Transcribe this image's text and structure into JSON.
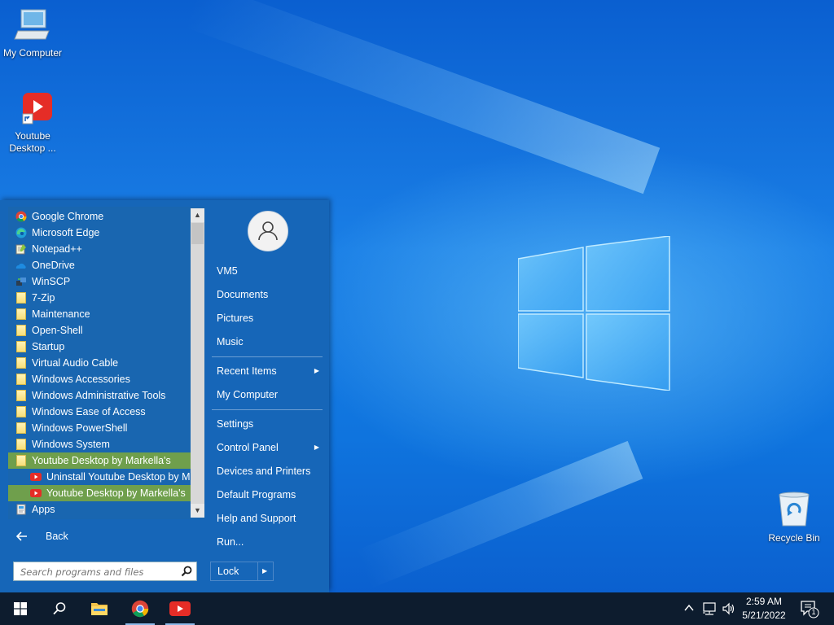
{
  "desktop": {
    "icons": [
      {
        "label": "My Computer"
      },
      {
        "label": "Youtube Desktop ..."
      },
      {
        "label": "Recycle Bin"
      }
    ]
  },
  "start_menu": {
    "programs": [
      {
        "label": "Google Chrome",
        "icon": "chrome-icon"
      },
      {
        "label": "Microsoft Edge",
        "icon": "edge-icon"
      },
      {
        "label": "Notepad++",
        "icon": "notepadpp-icon"
      },
      {
        "label": "OneDrive",
        "icon": "onedrive-icon"
      },
      {
        "label": "WinSCP",
        "icon": "winscp-icon"
      },
      {
        "label": "7-Zip",
        "icon": "folder-icon"
      },
      {
        "label": "Maintenance",
        "icon": "folder-icon"
      },
      {
        "label": "Open-Shell",
        "icon": "folder-icon"
      },
      {
        "label": "Startup",
        "icon": "folder-icon"
      },
      {
        "label": "Virtual Audio Cable",
        "icon": "folder-icon"
      },
      {
        "label": "Windows Accessories",
        "icon": "folder-icon"
      },
      {
        "label": "Windows Administrative Tools",
        "icon": "folder-icon"
      },
      {
        "label": "Windows Ease of Access",
        "icon": "folder-icon"
      },
      {
        "label": "Windows PowerShell",
        "icon": "folder-icon"
      },
      {
        "label": "Windows System",
        "icon": "folder-icon"
      },
      {
        "label": "Youtube Desktop by Markella's",
        "icon": "folder-icon"
      },
      {
        "label": "Uninstall Youtube Desktop by Markella's",
        "icon": "youtube-icon"
      },
      {
        "label": "Youtube Desktop by Markella's",
        "icon": "youtube-icon"
      },
      {
        "label": "Apps",
        "icon": "apps-icon"
      }
    ],
    "back_label": "Back",
    "search_placeholder": "Search programs and files",
    "right_items": {
      "user": "VM5",
      "documents": "Documents",
      "pictures": "Pictures",
      "music": "Music",
      "recent_items": "Recent Items",
      "my_computer": "My Computer",
      "settings": "Settings",
      "control_panel": "Control Panel",
      "devices_printers": "Devices and Printers",
      "default_programs": "Default Programs",
      "help_support": "Help and Support",
      "run": "Run..."
    },
    "lock_label": "Lock"
  },
  "taskbar": {
    "time": "2:59 AM",
    "date": "5/21/2022",
    "notification_count": "1"
  },
  "colors": {
    "accent": "#1666b8",
    "highlight": "#6f9f4c",
    "taskbar": "#0d1c2e"
  }
}
